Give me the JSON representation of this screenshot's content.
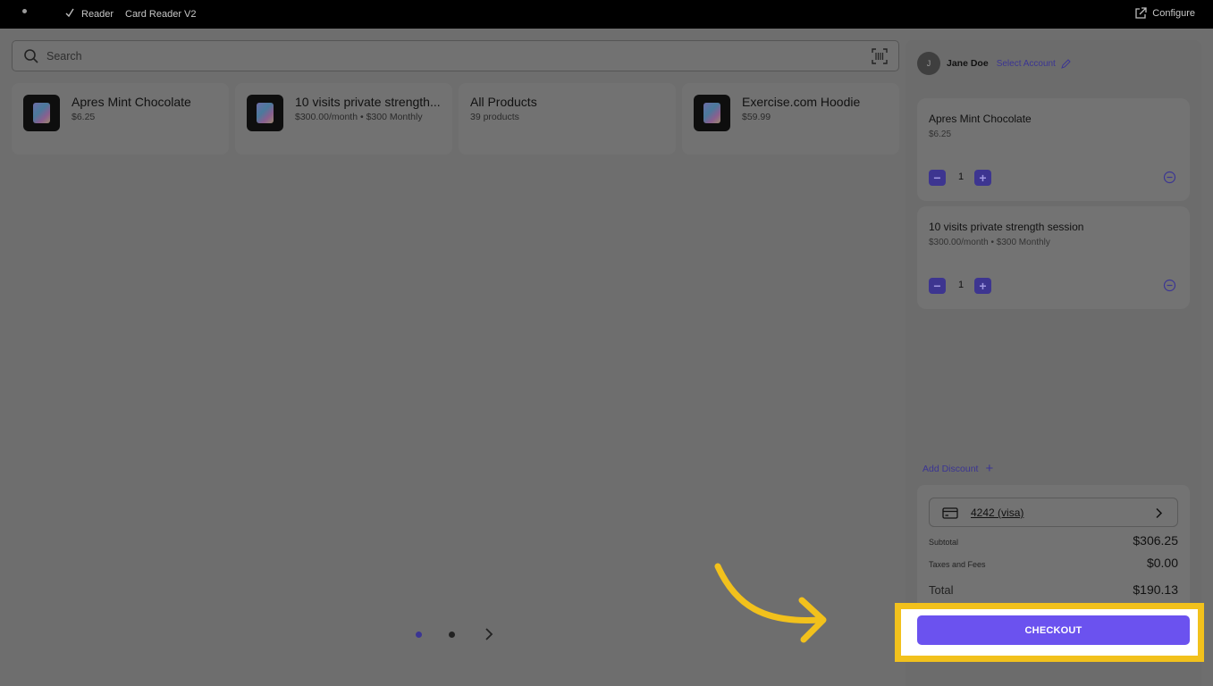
{
  "topbar": {
    "reader_label": "Reader",
    "device_label": "Card Reader V2",
    "configure_label": "Configure"
  },
  "search": {
    "placeholder": "Search"
  },
  "products": [
    {
      "name": "Apres Mint Chocolate",
      "subtitle": "$6.25",
      "has_image": true
    },
    {
      "name": "10 visits private strength...",
      "subtitle": "$300.00/month • $300 Monthly",
      "has_image": true
    },
    {
      "name": "All Products",
      "subtitle": "39 products",
      "has_image": false
    },
    {
      "name": "Exercise.com Hoodie",
      "subtitle": "$59.99",
      "has_image": true
    }
  ],
  "pagination": {
    "pages": 2,
    "current": 1
  },
  "account": {
    "avatar_initial": "J",
    "user_name": "Jane Doe",
    "select_label": "Select Account"
  },
  "cart": [
    {
      "name": "Apres Mint Chocolate",
      "price": "$6.25",
      "qty": "1",
      "minus": "−",
      "plus": "+"
    },
    {
      "name": "10 visits private strength session",
      "price": "$300.00/month • $300 Monthly",
      "qty": "1",
      "minus": "−",
      "plus": "+"
    }
  ],
  "discount": {
    "label": "Add Discount",
    "plus": "+"
  },
  "payment": {
    "card_label": "4242 (visa)"
  },
  "summary": {
    "subtotal_label": "Subtotal",
    "subtotal": "$306.25",
    "taxes_label": "Taxes and Fees",
    "taxes": "$0.00",
    "total_label": "Total",
    "total": "$190.13"
  },
  "checkout": {
    "label": "CHECKOUT"
  },
  "colors": {
    "accent": "#6b52ef",
    "highlight": "#f2c11c",
    "overlay_bg": "#6e6e6e"
  },
  "icons": [
    "check-icon",
    "external-link-icon",
    "search-icon",
    "barcode-scan-icon",
    "pencil-icon",
    "minus-icon",
    "plus-icon",
    "remove-circle-icon",
    "credit-card-icon",
    "chevron-right-icon",
    "annotation-arrow"
  ]
}
